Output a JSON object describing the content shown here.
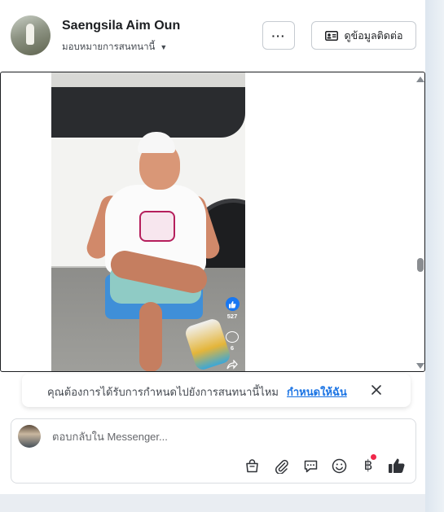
{
  "header": {
    "contact_name": "Saengsila Aim Oun",
    "assign_label": "มอบหมายการสนทนานี้",
    "more_label": "···",
    "view_contact_label": "ดูข้อมูลติดต่อ"
  },
  "video": {
    "like_count": "527",
    "comment_count": "6"
  },
  "prompt": {
    "text": "คุณต้องการได้รับการกำหนดไปยังการสนทนานี้ไหม",
    "link": "กำหนดให้ฉัน"
  },
  "reply": {
    "placeholder": "ตอบกลับใน Messenger..."
  },
  "toolbar": {
    "icons": [
      "shop-bag-icon",
      "paperclip-icon",
      "saved-reply-icon",
      "emoji-icon",
      "baht-payment-icon",
      "thumbs-up-icon"
    ],
    "baht_symbol": "฿"
  },
  "colors": {
    "accent": "#1b74e4",
    "notification_dot": "#f0284a",
    "like_blue": "#1877f2"
  }
}
